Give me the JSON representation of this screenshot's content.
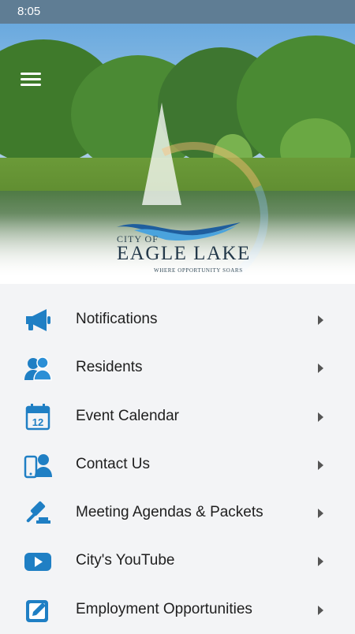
{
  "status_bar": {
    "time": "8:05"
  },
  "header": {
    "logo": {
      "line1": "City of",
      "line2": "Eagle Lake",
      "tagline": "Where Opportunity Soars"
    }
  },
  "colors": {
    "accent": "#1f7fc4",
    "status_bar": "#5f7d94"
  },
  "menu": {
    "items": [
      {
        "label": "Notifications",
        "icon": "megaphone-icon"
      },
      {
        "label": "Residents",
        "icon": "residents-icon"
      },
      {
        "label": "Event Calendar",
        "icon": "calendar-icon"
      },
      {
        "label": "Contact Us",
        "icon": "contact-icon"
      },
      {
        "label": "Meeting Agendas & Packets",
        "icon": "gavel-icon"
      },
      {
        "label": "City's YouTube",
        "icon": "youtube-icon"
      },
      {
        "label": "Employment Opportunities",
        "icon": "edit-icon"
      }
    ]
  }
}
